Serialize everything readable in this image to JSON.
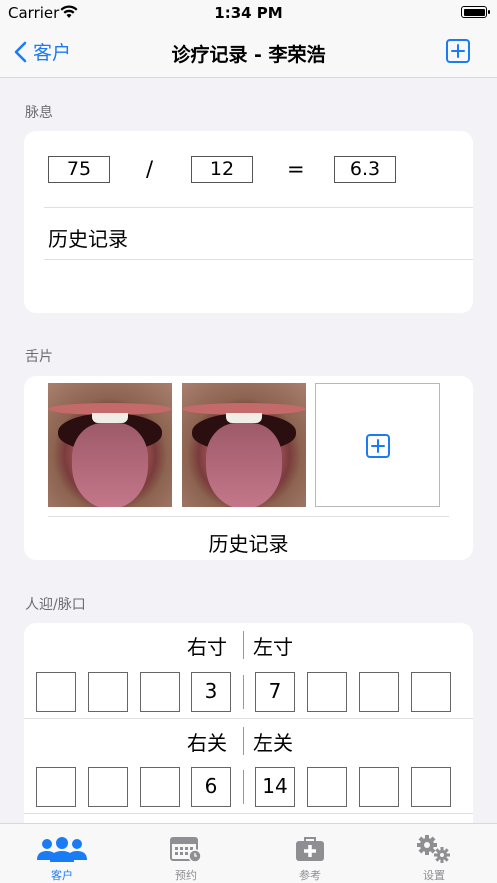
{
  "status_bar": {
    "carrier": "Carrier",
    "time": "1:34 PM"
  },
  "nav": {
    "back_label": "客户",
    "title": "诊疗记录 - 李荣浩"
  },
  "pulse_rate": {
    "section_label": "脉息",
    "value_a": "75",
    "operator_div": "/",
    "value_b": "12",
    "operator_eq": "=",
    "result": "6.3",
    "history_label": "历史记录"
  },
  "tongue": {
    "section_label": "舌片",
    "history_label": "历史记录"
  },
  "pulse_positions": {
    "section_label": "人迎/脉口",
    "rows": [
      {
        "right_label": "右寸",
        "left_label": "左寸",
        "right_values": [
          "",
          "",
          "",
          "3"
        ],
        "left_values": [
          "7",
          "",
          "",
          ""
        ]
      },
      {
        "right_label": "右关",
        "left_label": "左关",
        "right_values": [
          "",
          "",
          "",
          "6"
        ],
        "left_values": [
          "14",
          "",
          "",
          ""
        ]
      }
    ]
  },
  "tabs": [
    {
      "label": "客户",
      "icon": "people-icon",
      "active": true
    },
    {
      "label": "预约",
      "icon": "calendar-icon",
      "active": false
    },
    {
      "label": "参考",
      "icon": "medical-kit-icon",
      "active": false
    },
    {
      "label": "设置",
      "icon": "gears-icon",
      "active": false
    }
  ],
  "colors": {
    "accent": "#1a7cf5",
    "background": "#f2f2f7",
    "card": "#ffffff",
    "tab_inactive": "#8e8e93"
  }
}
